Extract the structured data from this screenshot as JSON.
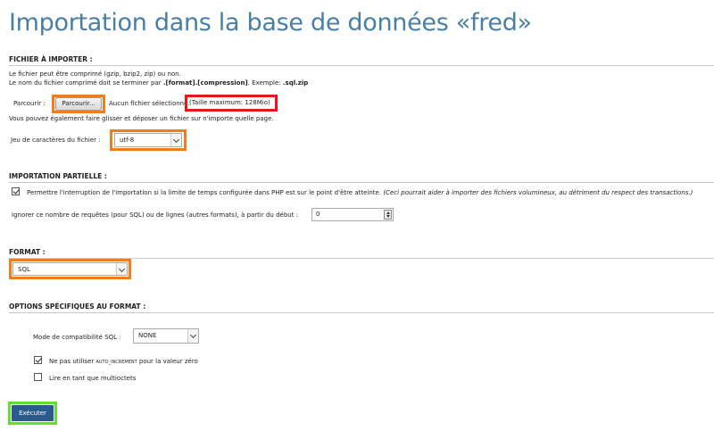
{
  "page": {
    "title": "Importation dans la base de données «fred»"
  },
  "file_section": {
    "heading": "FICHIER À IMPORTER :",
    "line1": "Le fichier peut être comprimé (gzip, bzip2, zip) ou non.",
    "line2_prefix": "Le nom du fichier comprimé doit se terminer par",
    "line2_format": ".[format].[compression]",
    "line2_mid": ". Exemple:",
    "line2_example": ".sql.zip",
    "browse_label": "Parcourir :",
    "browse_button": "Parcourir...",
    "no_file": "Aucun fichier sélectionné.",
    "max_size": "(Taille maximum: 128Mio)",
    "drag_drop": "Vous pouvez également faire glisser et déposer un fichier sur n'importe quelle page.",
    "charset_label": "Jeu de caractères du fichier :",
    "charset_value": "utf-8"
  },
  "partial_section": {
    "heading": "IMPORTATION PARTIELLE :",
    "interrupt_label": "Permettre l'interruption de l'importation si la limite de temps configurée dans PHP est sur le point d'être atteinte.",
    "interrupt_note": "(Ceci pourrait aider à importer des fichiers volumineux, au détriment du respect des transactions.)",
    "interrupt_checked": true,
    "skip_label": "Ignorer ce nombre de requêtes (pour SQL) ou de lignes (autres formats), à partir du début :",
    "skip_value": "0"
  },
  "format_section": {
    "heading": "FORMAT :",
    "format_value": "SQL"
  },
  "options_section": {
    "heading": "OPTIONS SPÉCIFIQUES AU FORMAT :",
    "compat_label": "Mode de compatibilité SQL :",
    "compat_value": "NONE",
    "no_auto_prefix": "Ne pas utiliser",
    "no_auto_code": "AUTO_INCREMENT",
    "no_auto_suffix": "pour la valeur zéro",
    "no_auto_checked": true,
    "multibyte_label": "Lire en tant que multioctets",
    "multibyte_checked": false
  },
  "actions": {
    "execute": "Exécuter"
  },
  "colors": {
    "title": "#4a7fa5",
    "highlight_orange": "#f07d1a",
    "highlight_red": "#e3171d",
    "highlight_green": "#5fe02a",
    "execute_button": "#2b5a8c"
  }
}
